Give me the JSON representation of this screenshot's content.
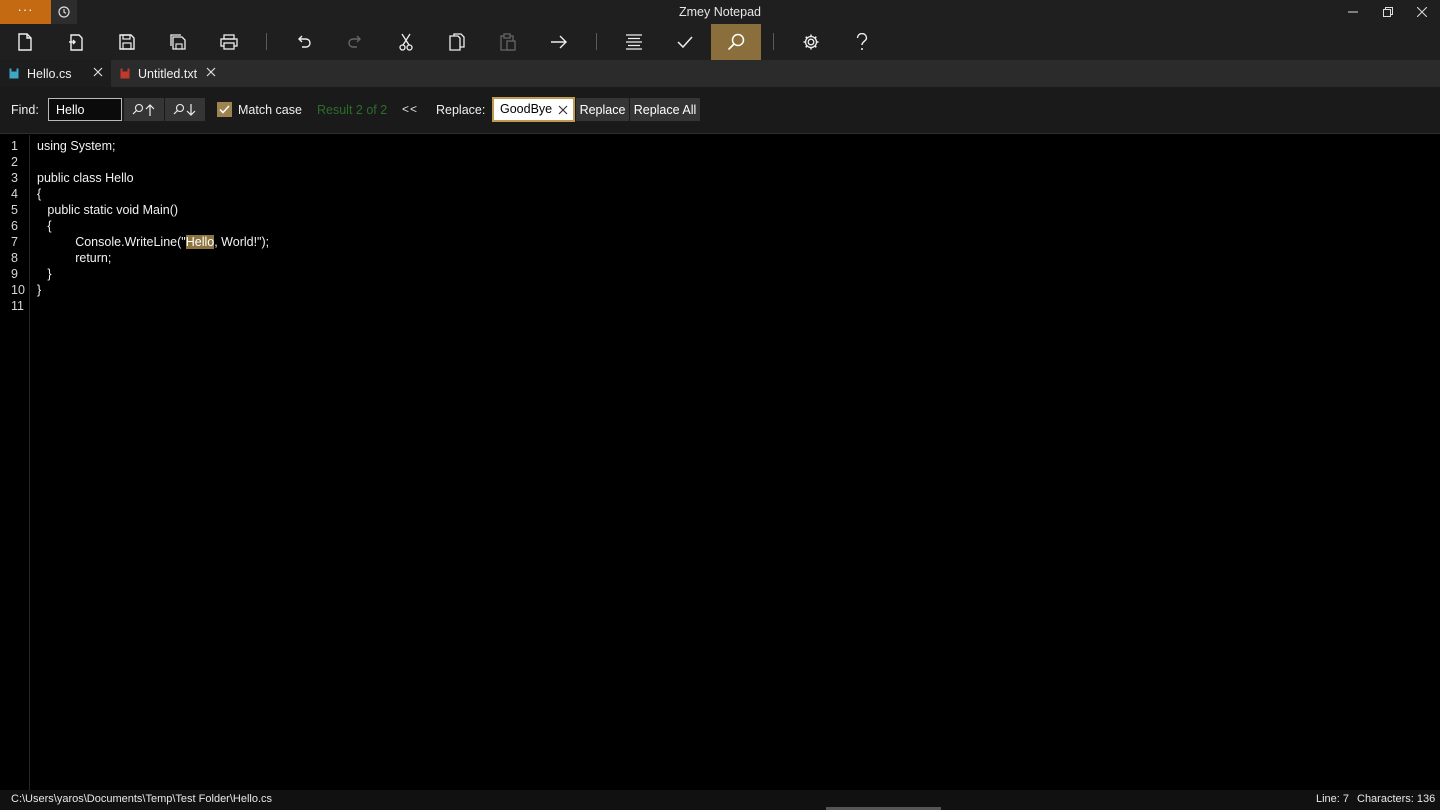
{
  "window": {
    "title": "Zmey Notepad",
    "menu_label": "···"
  },
  "toolbar": {
    "buttons": [
      {
        "name": "new-file",
        "icon": "new-file-icon"
      },
      {
        "name": "open-file",
        "icon": "open-file-icon"
      },
      {
        "name": "save",
        "icon": "save-icon"
      },
      {
        "name": "save-as",
        "icon": "save-as-icon"
      },
      {
        "name": "print",
        "icon": "print-icon"
      },
      {
        "name": "undo",
        "icon": "undo-icon"
      },
      {
        "name": "redo",
        "icon": "redo-icon"
      },
      {
        "name": "cut",
        "icon": "cut-icon"
      },
      {
        "name": "copy",
        "icon": "copy-icon"
      },
      {
        "name": "paste",
        "icon": "paste-icon"
      },
      {
        "name": "go-to",
        "icon": "arrow-right-icon"
      },
      {
        "name": "format",
        "icon": "align-icon"
      },
      {
        "name": "check",
        "icon": "check-icon"
      },
      {
        "name": "find",
        "icon": "search-icon",
        "active": true
      },
      {
        "name": "settings",
        "icon": "gear-icon"
      },
      {
        "name": "help",
        "icon": "help-icon"
      }
    ]
  },
  "tabs": [
    {
      "label": "Hello.cs",
      "icon_color": "#3fa6c4",
      "active": true
    },
    {
      "label": "Untitled.txt",
      "icon_color": "#c0392b",
      "active": false
    }
  ],
  "findbar": {
    "find_label": "Find:",
    "find_value": "Hello",
    "match_case_label": "Match case",
    "match_case_checked": true,
    "result_text": "Result 2 of 2",
    "collapse_label": "<<",
    "replace_label": "Replace:",
    "replace_value": "GoodBye",
    "replace_button": "Replace",
    "replace_all_button": "Replace All"
  },
  "editor": {
    "line_numbers": [
      "1",
      "2",
      "3",
      "4",
      "5",
      "6",
      "7",
      "8",
      "9",
      "10",
      "11"
    ],
    "lines": [
      {
        "before": "using System;"
      },
      {
        "before": ""
      },
      {
        "before": "public class Hello"
      },
      {
        "before": "{"
      },
      {
        "before": "   public static void Main()"
      },
      {
        "before": "   {"
      },
      {
        "before": "           Console.WriteLine(\"",
        "highlight": "Hello",
        "after": ", World!\");"
      },
      {
        "before": "           return;"
      },
      {
        "before": "   }"
      },
      {
        "before": "}"
      },
      {
        "before": ""
      }
    ]
  },
  "status": {
    "path": "C:\\Users\\yaros\\Documents\\Temp\\Test Folder\\Hello.cs",
    "line": "Line: 7",
    "characters": "Characters: 136"
  },
  "colors": {
    "accent": "#8a6f3c",
    "menu_button": "#c46a12",
    "result_text": "#2a6e2a"
  }
}
